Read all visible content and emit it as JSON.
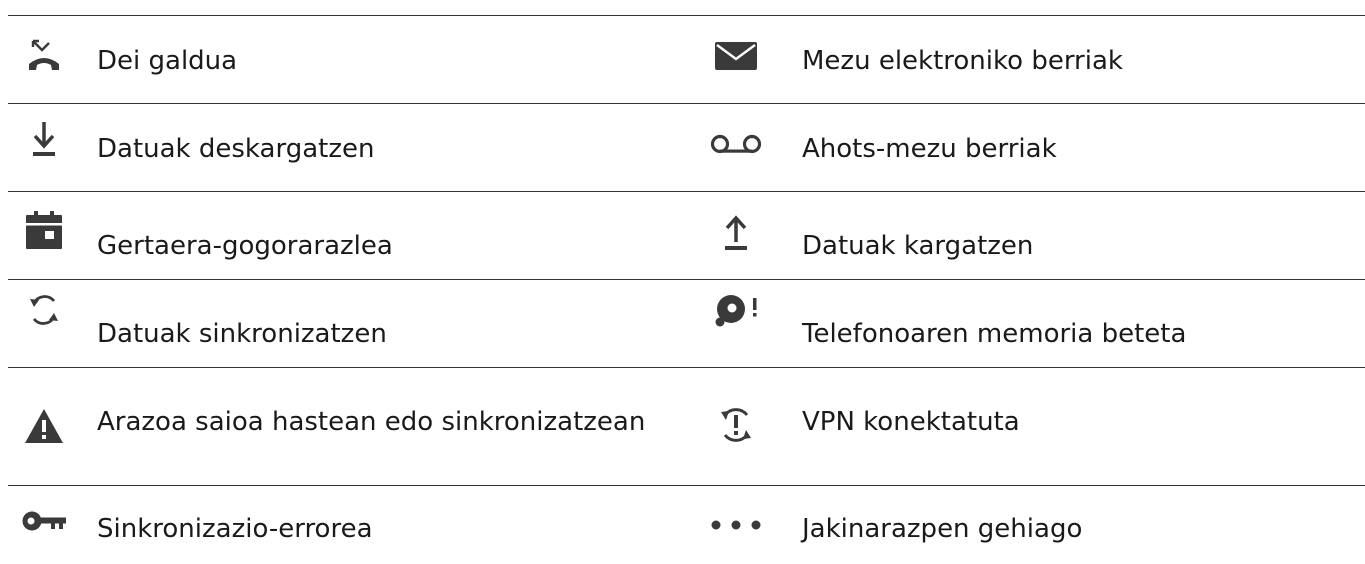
{
  "rows": [
    {
      "left": {
        "icon": "missed-call-icon",
        "label": "Dei galdua"
      },
      "right": {
        "icon": "mail-icon",
        "label": "Mezu elektroniko berriak"
      }
    },
    {
      "left": {
        "icon": "download-icon",
        "label": "Datuak deskargatzen"
      },
      "right": {
        "icon": "voicemail-icon",
        "label": "Ahots-mezu berriak"
      }
    },
    {
      "left": {
        "icon": "calendar-icon",
        "label": "Gertaera-gogorarazlea"
      },
      "right": {
        "icon": "upload-icon",
        "label": "Datuak kargatzen"
      }
    },
    {
      "left": {
        "icon": "sync-icon",
        "label": "Datuak sinkronizatzen"
      },
      "right": {
        "icon": "storage-full-icon",
        "label": "Telefonoaren memoria beteta"
      }
    },
    {
      "left": {
        "icon": "warning-icon",
        "label": "Arazoa saioa hastean edo sinkronizatzean"
      },
      "right": {
        "icon": "vpn-icon",
        "label": "VPN konektatuta"
      }
    },
    {
      "left": {
        "icon": "key-icon",
        "label": "Sinkronizazio-errorea"
      },
      "right": {
        "icon": "more-icon",
        "label": "Jakinarazpen gehiago"
      }
    }
  ]
}
